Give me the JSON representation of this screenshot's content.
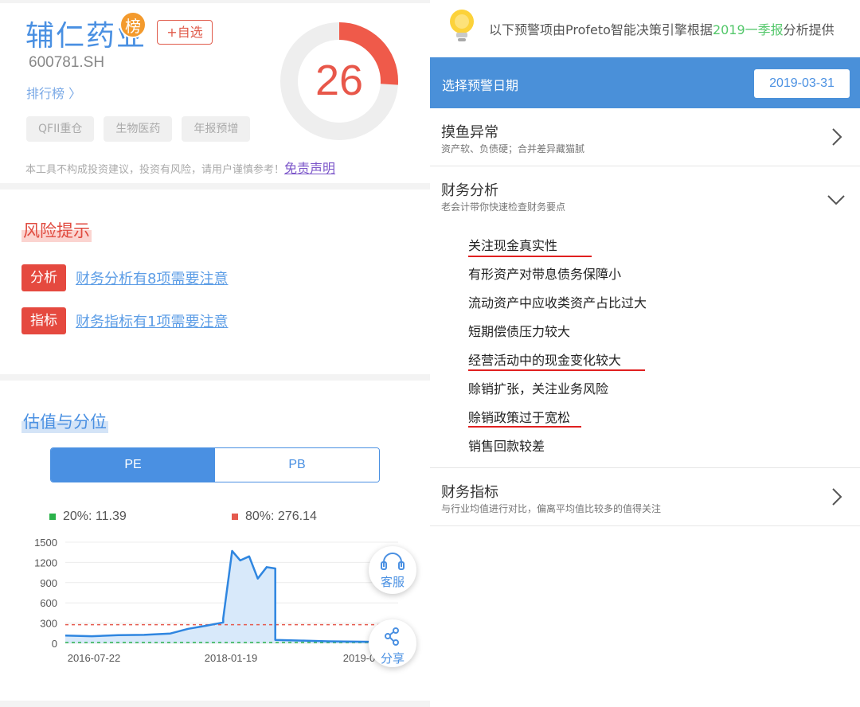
{
  "stock": {
    "name": "辅仁药业",
    "badge": "榜",
    "add_label": "+自选",
    "code": "600781.SH",
    "rank_link": "排行榜 〉",
    "score": "26",
    "score_fraction": 0.26,
    "tags": [
      "QFII重仓",
      "生物医药",
      "年报预增"
    ],
    "disclaimer": "本工具不构成投资建议，投资有风险，请用户谨慎参考！",
    "disclaimer_link": "免责声明"
  },
  "risk": {
    "title": "风险提示",
    "rows": [
      {
        "tag": "分析",
        "text": "财务分析有8项需要注意"
      },
      {
        "tag": "指标",
        "text": "财务指标有1项需要注意"
      }
    ]
  },
  "valuation": {
    "title": "估值与分位",
    "tabs": [
      "PE",
      "PB"
    ],
    "legend": [
      {
        "label": "20%: 11.39",
        "color": "#2ab24a"
      },
      {
        "label": "80%: 276.14",
        "color": "#e55a4e"
      }
    ]
  },
  "fab": {
    "service": "客服",
    "share": "分享"
  },
  "chart_data": {
    "type": "area",
    "ylim": [
      0,
      1500
    ],
    "yticks": [
      1500,
      1200,
      900,
      600,
      300,
      0
    ],
    "xticks": [
      "2016-07-22",
      "2018-01-19",
      "2019-07-19"
    ],
    "x": [
      "2016-07",
      "2016-10",
      "2017-01",
      "2017-04",
      "2017-07",
      "2017-09",
      "2017-11",
      "2018-01",
      "2018-01",
      "2018-02",
      "2018-03",
      "2018-04",
      "2018-05",
      "2018-06",
      "2018-07",
      "2018-07",
      "2018-10",
      "2019-01",
      "2019-04",
      "2019-07",
      "2019-09"
    ],
    "values": [
      115,
      105,
      120,
      125,
      145,
      215,
      260,
      310,
      370,
      1370,
      1230,
      1290,
      960,
      1130,
      1110,
      50,
      40,
      30,
      25,
      20,
      15
    ],
    "reference_lines": [
      {
        "label": "20%",
        "value": 11.39,
        "color": "#2ab24a"
      },
      {
        "label": "80%",
        "value": 276.14,
        "color": "#e55a4e"
      }
    ],
    "line_color": "#2f86e0",
    "fill_color": "#d8e9fa"
  },
  "notice": {
    "prefix": "以下预警项由Profeto智能决策引擎根据",
    "highlight": "2019一季报",
    "suffix": "分析提供"
  },
  "date_bar": {
    "label": "选择预警日期",
    "value": "2019-03-31"
  },
  "sections": [
    {
      "title": "摸鱼异常",
      "subtitle": "资产软、负债硬；合并差异藏猫腻"
    },
    {
      "title": "财务分析",
      "subtitle": "老会计带你快速检查财务要点",
      "items": [
        "关注现金真实性",
        "有形资产对带息债务保障小",
        "流动资产中应收类资产占比过大",
        "短期偿债压力较大",
        "经营活动中的现金变化较大",
        "赊销扩张，关注业务风险",
        "赊销政策过于宽松",
        "销售回款较差"
      ]
    },
    {
      "title": "财务指标",
      "subtitle": "与行业均值进行对比，偏离平均值比较多的值得关注"
    }
  ]
}
